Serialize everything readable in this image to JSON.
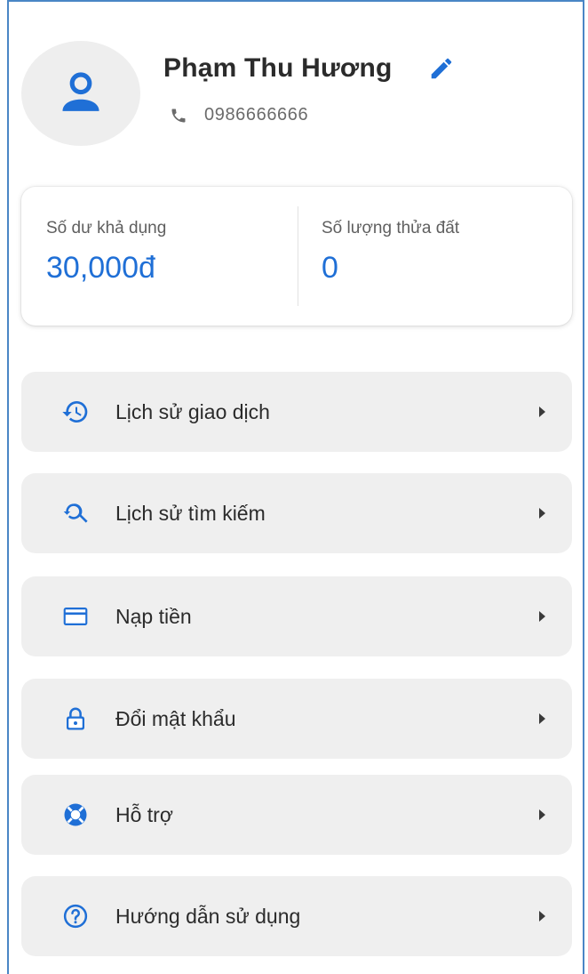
{
  "profile": {
    "name": "Phạm Thu Hương",
    "phone": "0986666666",
    "avatar_icon": "person-icon",
    "edit_icon": "pencil-icon",
    "phone_icon": "phone-icon"
  },
  "stats": {
    "balance_label": "Số dư khả dụng",
    "balance_value": "30,000đ",
    "parcels_label": "Số lượng thửa đất",
    "parcels_value": "0"
  },
  "menu": {
    "items": [
      {
        "label": "Lịch sử giao dịch",
        "icon": "history-icon"
      },
      {
        "label": "Lịch sử tìm kiếm",
        "icon": "search-history-icon"
      },
      {
        "label": "Nạp tiền",
        "icon": "credit-card-icon"
      },
      {
        "label": "Đổi mật khẩu",
        "icon": "lock-icon"
      },
      {
        "label": "Hỗ trợ",
        "icon": "lifebuoy-icon"
      },
      {
        "label": "Hướng dẫn sử dụng",
        "icon": "help-circle-icon"
      }
    ]
  },
  "colors": {
    "accent": "#1f6fd6",
    "item_background": "#efefef",
    "avatar_background": "#eeeeee",
    "frame_border": "#4a86c5"
  }
}
